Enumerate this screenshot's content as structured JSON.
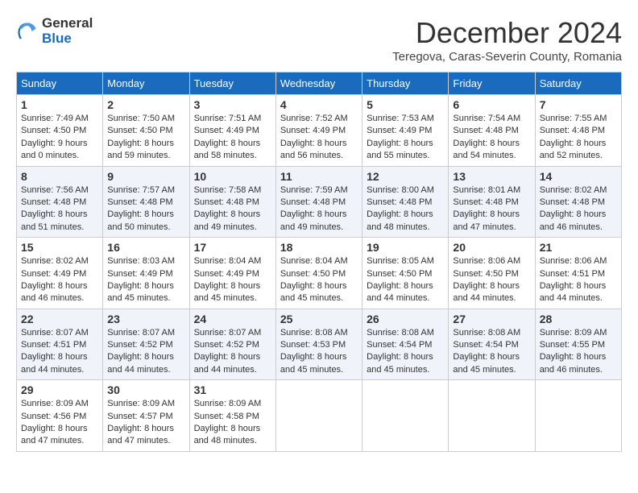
{
  "logo": {
    "general": "General",
    "blue": "Blue"
  },
  "title": "December 2024",
  "subtitle": "Teregova, Caras-Severin County, Romania",
  "days_of_week": [
    "Sunday",
    "Monday",
    "Tuesday",
    "Wednesday",
    "Thursday",
    "Friday",
    "Saturday"
  ],
  "weeks": [
    [
      {
        "day": "1",
        "sunrise": "7:49 AM",
        "sunset": "4:50 PM",
        "daylight": "9 hours and 0 minutes."
      },
      {
        "day": "2",
        "sunrise": "7:50 AM",
        "sunset": "4:50 PM",
        "daylight": "8 hours and 59 minutes."
      },
      {
        "day": "3",
        "sunrise": "7:51 AM",
        "sunset": "4:49 PM",
        "daylight": "8 hours and 58 minutes."
      },
      {
        "day": "4",
        "sunrise": "7:52 AM",
        "sunset": "4:49 PM",
        "daylight": "8 hours and 56 minutes."
      },
      {
        "day": "5",
        "sunrise": "7:53 AM",
        "sunset": "4:49 PM",
        "daylight": "8 hours and 55 minutes."
      },
      {
        "day": "6",
        "sunrise": "7:54 AM",
        "sunset": "4:48 PM",
        "daylight": "8 hours and 54 minutes."
      },
      {
        "day": "7",
        "sunrise": "7:55 AM",
        "sunset": "4:48 PM",
        "daylight": "8 hours and 52 minutes."
      }
    ],
    [
      {
        "day": "8",
        "sunrise": "7:56 AM",
        "sunset": "4:48 PM",
        "daylight": "8 hours and 51 minutes."
      },
      {
        "day": "9",
        "sunrise": "7:57 AM",
        "sunset": "4:48 PM",
        "daylight": "8 hours and 50 minutes."
      },
      {
        "day": "10",
        "sunrise": "7:58 AM",
        "sunset": "4:48 PM",
        "daylight": "8 hours and 49 minutes."
      },
      {
        "day": "11",
        "sunrise": "7:59 AM",
        "sunset": "4:48 PM",
        "daylight": "8 hours and 49 minutes."
      },
      {
        "day": "12",
        "sunrise": "8:00 AM",
        "sunset": "4:48 PM",
        "daylight": "8 hours and 48 minutes."
      },
      {
        "day": "13",
        "sunrise": "8:01 AM",
        "sunset": "4:48 PM",
        "daylight": "8 hours and 47 minutes."
      },
      {
        "day": "14",
        "sunrise": "8:02 AM",
        "sunset": "4:48 PM",
        "daylight": "8 hours and 46 minutes."
      }
    ],
    [
      {
        "day": "15",
        "sunrise": "8:02 AM",
        "sunset": "4:49 PM",
        "daylight": "8 hours and 46 minutes."
      },
      {
        "day": "16",
        "sunrise": "8:03 AM",
        "sunset": "4:49 PM",
        "daylight": "8 hours and 45 minutes."
      },
      {
        "day": "17",
        "sunrise": "8:04 AM",
        "sunset": "4:49 PM",
        "daylight": "8 hours and 45 minutes."
      },
      {
        "day": "18",
        "sunrise": "8:04 AM",
        "sunset": "4:50 PM",
        "daylight": "8 hours and 45 minutes."
      },
      {
        "day": "19",
        "sunrise": "8:05 AM",
        "sunset": "4:50 PM",
        "daylight": "8 hours and 44 minutes."
      },
      {
        "day": "20",
        "sunrise": "8:06 AM",
        "sunset": "4:50 PM",
        "daylight": "8 hours and 44 minutes."
      },
      {
        "day": "21",
        "sunrise": "8:06 AM",
        "sunset": "4:51 PM",
        "daylight": "8 hours and 44 minutes."
      }
    ],
    [
      {
        "day": "22",
        "sunrise": "8:07 AM",
        "sunset": "4:51 PM",
        "daylight": "8 hours and 44 minutes."
      },
      {
        "day": "23",
        "sunrise": "8:07 AM",
        "sunset": "4:52 PM",
        "daylight": "8 hours and 44 minutes."
      },
      {
        "day": "24",
        "sunrise": "8:07 AM",
        "sunset": "4:52 PM",
        "daylight": "8 hours and 44 minutes."
      },
      {
        "day": "25",
        "sunrise": "8:08 AM",
        "sunset": "4:53 PM",
        "daylight": "8 hours and 45 minutes."
      },
      {
        "day": "26",
        "sunrise": "8:08 AM",
        "sunset": "4:54 PM",
        "daylight": "8 hours and 45 minutes."
      },
      {
        "day": "27",
        "sunrise": "8:08 AM",
        "sunset": "4:54 PM",
        "daylight": "8 hours and 45 minutes."
      },
      {
        "day": "28",
        "sunrise": "8:09 AM",
        "sunset": "4:55 PM",
        "daylight": "8 hours and 46 minutes."
      }
    ],
    [
      {
        "day": "29",
        "sunrise": "8:09 AM",
        "sunset": "4:56 PM",
        "daylight": "8 hours and 47 minutes."
      },
      {
        "day": "30",
        "sunrise": "8:09 AM",
        "sunset": "4:57 PM",
        "daylight": "8 hours and 47 minutes."
      },
      {
        "day": "31",
        "sunrise": "8:09 AM",
        "sunset": "4:58 PM",
        "daylight": "8 hours and 48 minutes."
      },
      null,
      null,
      null,
      null
    ]
  ]
}
